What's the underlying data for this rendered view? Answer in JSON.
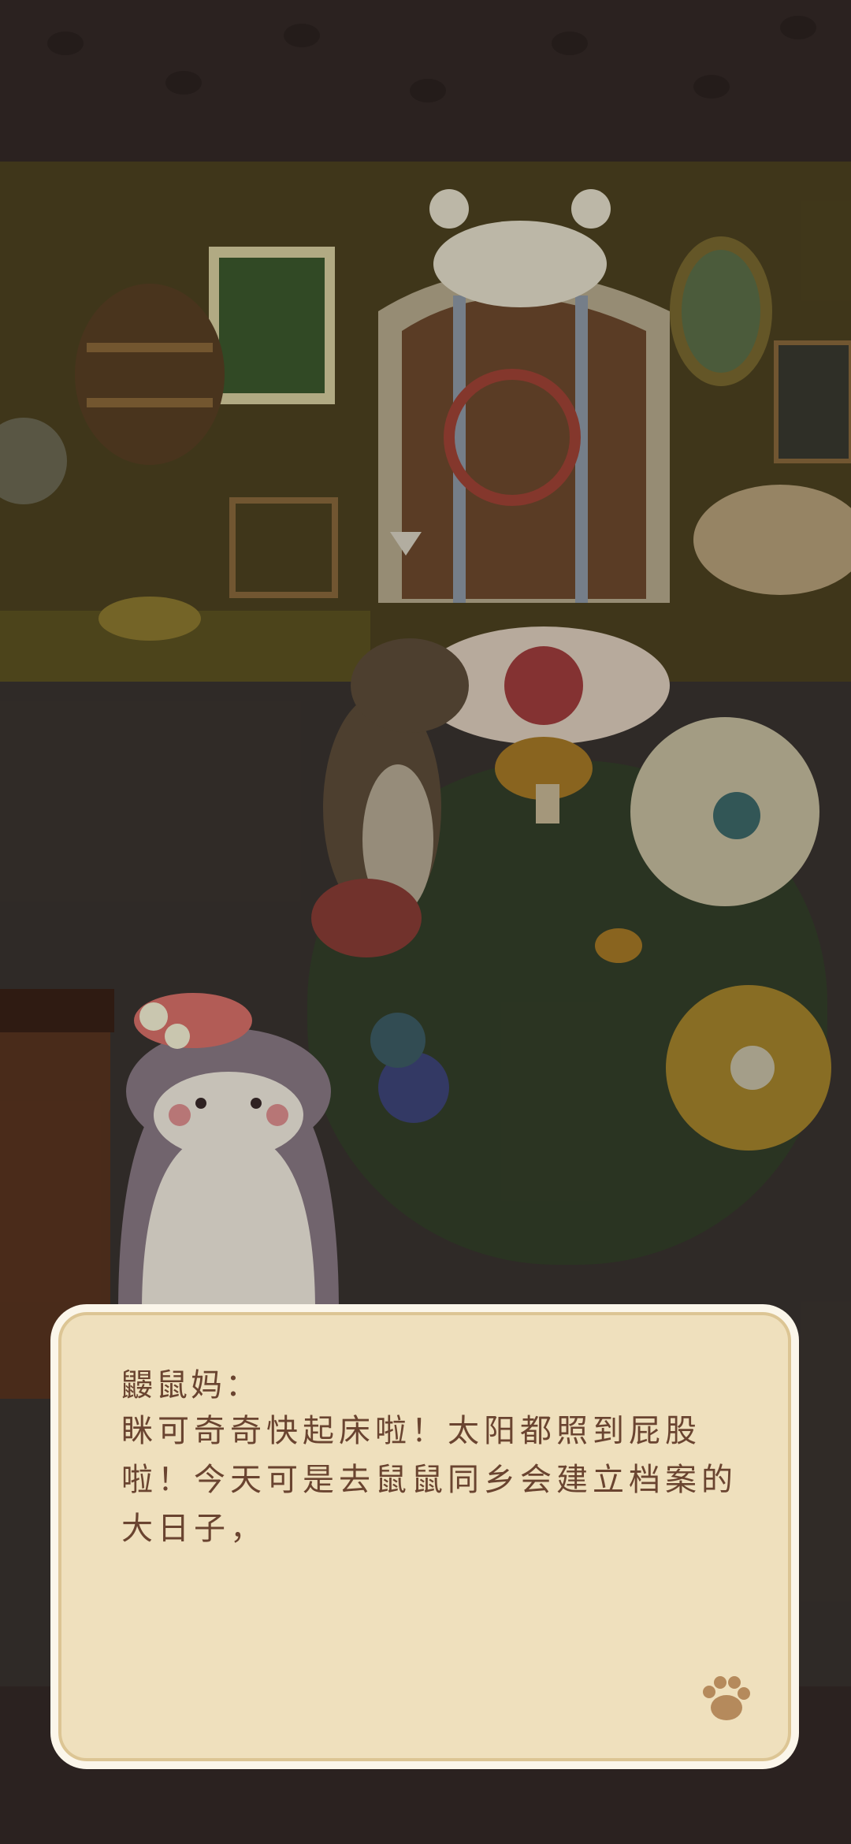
{
  "scene": {
    "name": "otter-home-room",
    "colors": {
      "wall": "#4e4320",
      "floor": "#3a3430",
      "band": "#2b2220",
      "dialog_bg": "#efe0bd",
      "dialog_text": "#6a4430"
    }
  },
  "dialog": {
    "speaker": "鼹鼠妈：",
    "text": "眯可奇奇快起床啦！太阳都照到屁股啦！今天可是去鼠鼠同乡会建立档案的大日子，",
    "advance_icon": "paw-icon"
  }
}
